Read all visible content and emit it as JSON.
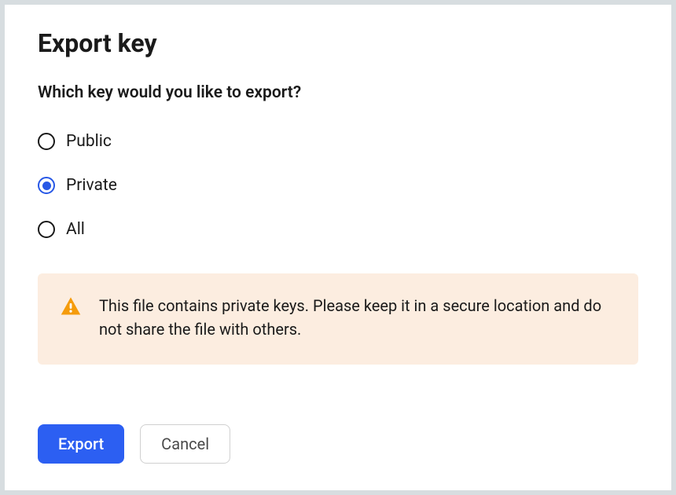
{
  "dialog": {
    "title": "Export key",
    "question": "Which key would you like to export?"
  },
  "options": {
    "public": "Public",
    "private": "Private",
    "all": "All",
    "selected": "private"
  },
  "warning": {
    "text": "This file contains private keys. Please keep it in a secure location and do not share the file with others."
  },
  "buttons": {
    "export": "Export",
    "cancel": "Cancel"
  }
}
